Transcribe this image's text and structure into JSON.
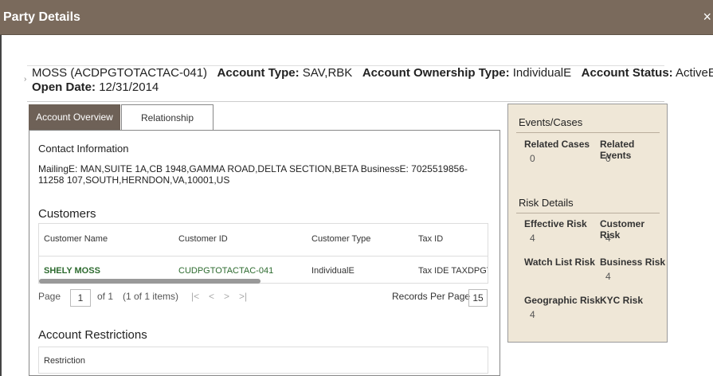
{
  "dialog": {
    "title": "Party Details",
    "close_glyph": "×"
  },
  "header": {
    "party": "MOSS (ACDPGTOTACTAC-041)",
    "account_type_label": "Account Type:",
    "account_type": "SAV,RBK",
    "ownership_type_label": "Account Ownership Type:",
    "ownership_type": "IndividualE",
    "status_label": "Account Status:",
    "status": "ActiveE",
    "open_date_label": "Open Date:",
    "open_date": "12/31/2014"
  },
  "tabs": [
    "Account Overview",
    "Relationship"
  ],
  "contact": {
    "title": "Contact Information",
    "text": "MailingE: MAN,SUITE 1A,CB 1948,GAMMA ROAD,DELTA SECTION,BETA  BusinessE: 7025519856-11258 107,SOUTH,HERNDON,VA,10001,US"
  },
  "customers": {
    "title": "Customers",
    "columns": [
      "Customer Name",
      "Customer ID",
      "Customer Type",
      "Tax ID"
    ],
    "rows": [
      {
        "name": "SHELY MOSS",
        "id": "CUDPGTOTACTAC-041",
        "type": "IndividualE",
        "tax": "Tax IDE TAXDPGT"
      }
    ],
    "pager": {
      "page_label": "Page",
      "page": "1",
      "of_text": "of 1",
      "items_text": "(1 of 1 items)",
      "first": "|<",
      "prev": "<",
      "next": ">",
      "last": ">|",
      "records_label": "Records Per Page",
      "records": "15"
    }
  },
  "restrictions": {
    "title": "Account Restrictions",
    "columns": [
      "Restriction"
    ]
  },
  "side": {
    "events_title": "Events/Cases",
    "related_cases_label": "Related Cases",
    "related_cases": "0",
    "related_events_label": "Related Events",
    "related_events": "0",
    "risk_title": "Risk Details",
    "effective_risk_label": "Effective Risk",
    "effective_risk": "4",
    "customer_risk_label": "Customer Risk",
    "customer_risk": "4",
    "watch_list_label": "Watch List Risk",
    "business_risk_label": "Business Risk",
    "business_risk": "4",
    "geographic_label": "Geographic Risk",
    "geographic_risk": "4",
    "kyc_label": "KYC Risk"
  }
}
